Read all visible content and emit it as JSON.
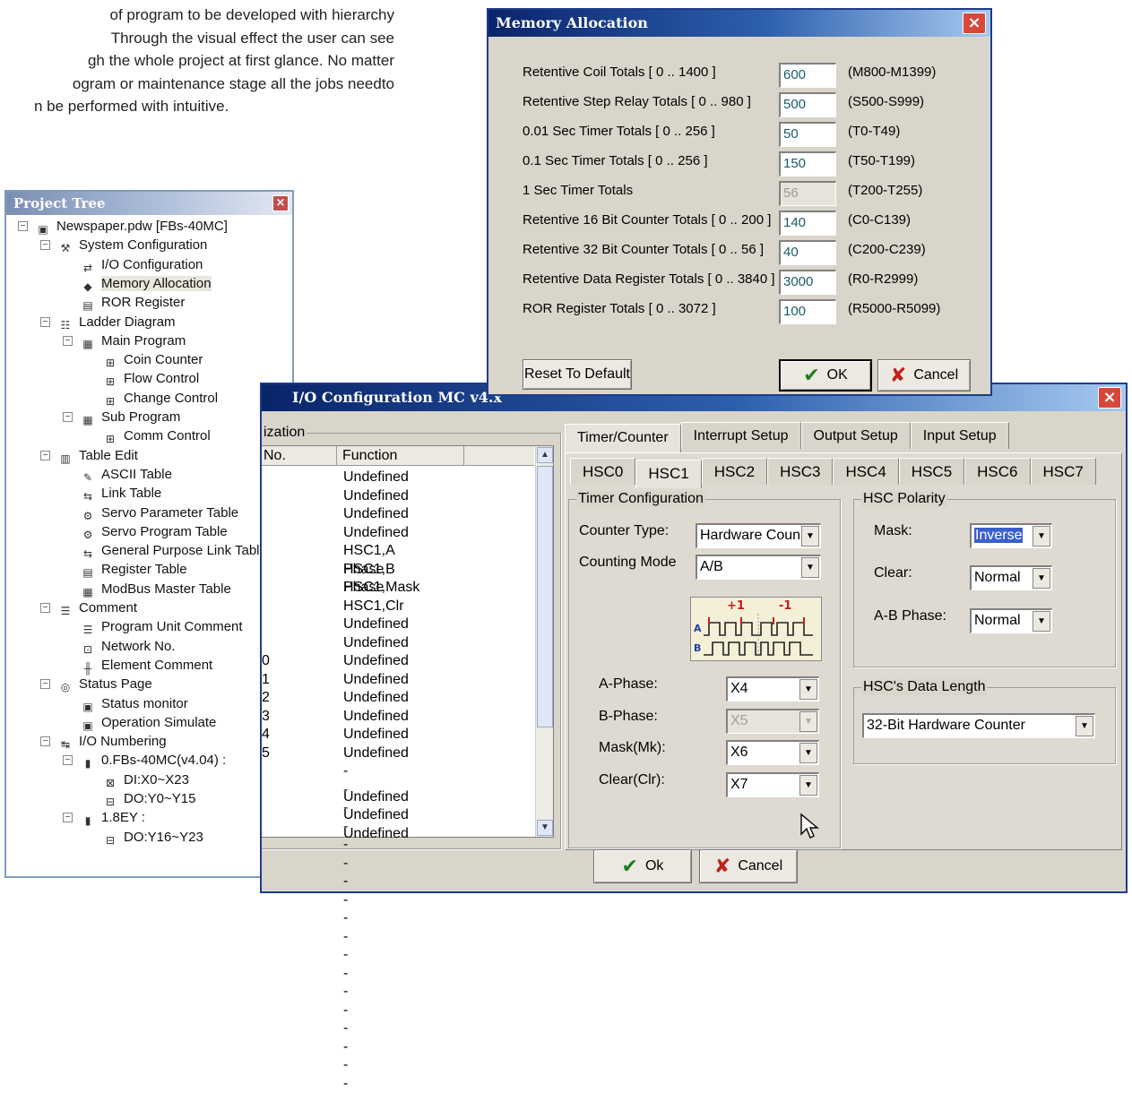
{
  "intro": {
    "lines": [
      "of program to be developed with hierarchy",
      "Through the visual effect the user can see",
      "gh the whole project at first glance. No matter",
      "ogram or maintenance stage all the jobs needto",
      "n be performed with intuitive."
    ]
  },
  "tree": {
    "title": "Project Tree",
    "nodes": [
      {
        "label": "Newspaper.pdw [FBs-40MC]",
        "icon": "project-icon"
      },
      {
        "label": "System Configuration",
        "icon": "tools-icon"
      },
      {
        "label": "I/O Configuration",
        "icon": "io-config-icon"
      },
      {
        "label": "Memory Allocation",
        "icon": "memory-icon"
      },
      {
        "label": "ROR Register",
        "icon": "register-icon"
      },
      {
        "label": "Ladder Diagram",
        "icon": "ladder-icon"
      },
      {
        "label": "Main Program",
        "icon": "program-icon"
      },
      {
        "label": "Coin Counter",
        "icon": "subroutine-icon"
      },
      {
        "label": "Flow Control",
        "icon": "subroutine-icon"
      },
      {
        "label": "Change Control",
        "icon": "subroutine-icon"
      },
      {
        "label": "Sub Program",
        "icon": "program-icon"
      },
      {
        "label": "Comm Control",
        "icon": "subroutine-icon"
      },
      {
        "label": "Table Edit",
        "icon": "table-icon"
      },
      {
        "label": "ASCII Table",
        "icon": "ascii-icon"
      },
      {
        "label": "Link Table",
        "icon": "link-icon"
      },
      {
        "label": "Servo Parameter Table",
        "icon": "servo-icon"
      },
      {
        "label": "Servo Program Table",
        "icon": "servo-icon"
      },
      {
        "label": "General Purpose Link Table",
        "icon": "link-icon"
      },
      {
        "label": "Register Table",
        "icon": "register-icon"
      },
      {
        "label": "ModBus Master Table",
        "icon": "modbus-icon"
      },
      {
        "label": "Comment",
        "icon": "comment-icon"
      },
      {
        "label": "Program Unit Comment",
        "icon": "comment-icon"
      },
      {
        "label": "Network No.",
        "icon": "network-icon"
      },
      {
        "label": "Element Comment",
        "icon": "element-icon"
      },
      {
        "label": "Status Page",
        "icon": "status-icon"
      },
      {
        "label": "Status monitor",
        "icon": "monitor-icon"
      },
      {
        "label": "Operation Simulate",
        "icon": "monitor-icon"
      },
      {
        "label": "I/O Numbering",
        "icon": "io-numbering-icon"
      },
      {
        "label": "0.FBs-40MC(v4.04) :",
        "icon": "plc-icon"
      },
      {
        "label": "DI:X0~X23",
        "icon": "input-icon"
      },
      {
        "label": "DO:Y0~Y15",
        "icon": "output-icon"
      },
      {
        "label": "1.8EY :",
        "icon": "plc-icon"
      },
      {
        "label": "DO:Y16~Y23",
        "icon": "output-icon"
      }
    ]
  },
  "memory": {
    "title": "Memory Allocation",
    "rows": [
      {
        "label": "Retentive Coil Totals [ 0 .. 1400 ]",
        "value": "600",
        "range": "(M800-M1399)"
      },
      {
        "label": "Retentive Step Relay Totals [ 0 .. 980 ]",
        "value": "500",
        "range": "(S500-S999)"
      },
      {
        "label": "0.01 Sec Timer Totals [ 0 .. 256 ]",
        "value": "50",
        "range": "(T0-T49)"
      },
      {
        "label": "0.1 Sec Timer Totals [ 0 .. 256 ]",
        "value": "150",
        "range": "(T50-T199)"
      },
      {
        "label": "1 Sec Timer Totals",
        "value": "56",
        "range": "(T200-T255)"
      },
      {
        "label": "Retentive 16 Bit Counter Totals [ 0 .. 200 ]",
        "value": "140",
        "range": "(C0-C139)"
      },
      {
        "label": "Retentive 32 Bit Counter Totals [ 0 .. 56 ]",
        "value": "40",
        "range": "(C200-C239)"
      },
      {
        "label": "Retentive Data Register Totals [ 0 .. 3840 ]",
        "value": "3000",
        "range": "(R0-R2999)"
      },
      {
        "label": "ROR Register Totals [ 0 .. 3072 ]",
        "value": "100",
        "range": "(R5000-R5099)"
      }
    ],
    "reset_label": "Reset To Default",
    "ok_label": "OK",
    "cancel_label": "Cancel"
  },
  "io": {
    "title": "I/O Configuration MC v4.x",
    "left_group": "ization",
    "col_no": "No.",
    "col_function": "Function",
    "rows": [
      {
        "no": "",
        "fn": "Undefined"
      },
      {
        "no": "",
        "fn": "Undefined"
      },
      {
        "no": "",
        "fn": "Undefined"
      },
      {
        "no": "",
        "fn": "Undefined"
      },
      {
        "no": "",
        "fn": "HSC1,A Phase"
      },
      {
        "no": "",
        "fn": "HSC1,B Phase"
      },
      {
        "no": "",
        "fn": "HSC1,Mask"
      },
      {
        "no": "",
        "fn": "HSC1,Clr"
      },
      {
        "no": "",
        "fn": "Undefined"
      },
      {
        "no": "",
        "fn": "Undefined"
      },
      {
        "no": "0",
        "fn": "Undefined"
      },
      {
        "no": "1",
        "fn": "Undefined"
      },
      {
        "no": "2",
        "fn": "Undefined"
      },
      {
        "no": "3",
        "fn": "Undefined"
      },
      {
        "no": "4",
        "fn": "Undefined"
      },
      {
        "no": "5",
        "fn": "Undefined"
      },
      {
        "no": "",
        "fn": "------------------"
      },
      {
        "no": "",
        "fn": "Undefined"
      },
      {
        "no": "",
        "fn": "Undefined"
      },
      {
        "no": "",
        "fn": "Undefined"
      }
    ],
    "main_tabs": [
      "Timer/Counter",
      "Interrupt Setup",
      "Output Setup",
      "Input Setup"
    ],
    "hsc_tabs": [
      "HSC0",
      "HSC1",
      "HSC2",
      "HSC3",
      "HSC4",
      "HSC5",
      "HSC6",
      "HSC7"
    ],
    "timer_group": "Timer Configuration",
    "counter_type_label": "Counter Type:",
    "counter_type_value": "Hardware Coun",
    "counting_mode_label": "Counting Mode",
    "counting_mode_value": "A/B",
    "diagram": {
      "plus": "+1",
      "minus": "-1",
      "a": "A",
      "b": "B"
    },
    "a_phase_label": "A-Phase:",
    "a_phase_value": "X4",
    "b_phase_label": "B-Phase:",
    "b_phase_value": "X5",
    "mask_label": "Mask(Mk):",
    "mask_value": "X6",
    "clear_label": "Clear(Clr):",
    "clear_value": "X7",
    "polarity_group": "HSC Polarity",
    "pol_mask_label": "Mask:",
    "pol_mask_value": "Inverse",
    "pol_clear_label": "Clear:",
    "pol_clear_value": "Normal",
    "pol_ab_label": "A-B Phase:",
    "pol_ab_value": "Normal",
    "data_length_group": "HSC's Data Length",
    "data_length_value": "32-Bit Hardware Counter",
    "ok_label": "Ok",
    "cancel_label": "Cancel"
  }
}
